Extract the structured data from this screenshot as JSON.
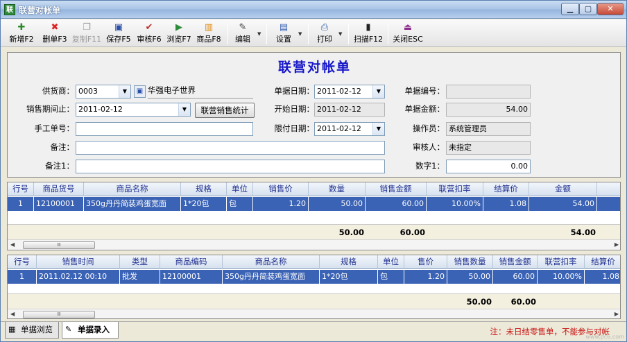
{
  "window": {
    "title": "联营对帐单",
    "app_icon_text": "联"
  },
  "toolbar": {
    "items": [
      {
        "label": "新增F2",
        "icon": "add-icon",
        "glyph": "✚"
      },
      {
        "label": "删单F3",
        "icon": "delete-icon",
        "glyph": "✖"
      },
      {
        "label": "复制F11",
        "icon": "copy-icon",
        "glyph": "❐"
      },
      {
        "label": "保存F5",
        "icon": "save-icon",
        "glyph": "▣"
      },
      {
        "label": "审核F6",
        "icon": "audit-icon",
        "glyph": "✔"
      },
      {
        "label": "浏览F7",
        "icon": "browse-icon",
        "glyph": "▶"
      },
      {
        "label": "商品F8",
        "icon": "product-icon",
        "glyph": "▥"
      },
      {
        "label": "编辑",
        "icon": "edit-icon",
        "glyph": "✎"
      },
      {
        "label": "设置",
        "icon": "settings-icon",
        "glyph": "▤"
      },
      {
        "label": "打印",
        "icon": "print-icon",
        "glyph": "⎙"
      },
      {
        "label": "扫描F12",
        "icon": "barcode-icon",
        "glyph": "▮"
      },
      {
        "label": "关闭ESC",
        "icon": "exit-icon",
        "glyph": "⏏"
      }
    ]
  },
  "form": {
    "title": "联营对帐单",
    "supplier_label": "供货商：",
    "supplier_code": "0003",
    "supplier_name": "华强电子世界",
    "sales_period_label": "销售期间止：",
    "sales_period_value": "2011-02-12",
    "stat_button": "联营销售统计",
    "manual_no_label": "手工单号：",
    "manual_no_value": "",
    "remark_label": "备注：",
    "remark_value": "",
    "remark1_label": "备注1：",
    "remark1_value": "",
    "doc_date_label": "单据日期：",
    "doc_date_value": "2011-02-12",
    "start_date_label": "开始日期：",
    "start_date_value": "2011-02-12",
    "limit_date_label": "限付日期：",
    "limit_date_value": "2011-02-12",
    "doc_no_label": "单据编号：",
    "doc_no_value": "",
    "doc_amount_label": "单据金额：",
    "doc_amount_value": "54.00",
    "operator_label": "操作员：",
    "operator_value": "系统管理员",
    "auditor_label": "审核人：",
    "auditor_value": "未指定",
    "number1_label": "数字1：",
    "number1_value": "0.00"
  },
  "grid1": {
    "headers": [
      "行号",
      "商品货号",
      "商品名称",
      "规格",
      "单位",
      "销售价",
      "数量",
      "销售金额",
      "联营扣率",
      "结算价",
      "金额"
    ],
    "rows": [
      [
        "1",
        "12100001",
        "350g丹丹简装鸡蛋宽面",
        "1*20包",
        "包",
        "1.20",
        "50.00",
        "60.00",
        "10.00%",
        "1.08",
        "54.00"
      ]
    ],
    "totals": {
      "qty": "50.00",
      "sales_amount": "60.00",
      "amount": "54.00"
    }
  },
  "grid2": {
    "headers": [
      "行号",
      "销售时间",
      "类型",
      "商品编码",
      "商品名称",
      "规格",
      "单位",
      "售价",
      "销售数量",
      "销售金额",
      "联营扣率",
      "结算价"
    ],
    "rows": [
      [
        "1",
        "2011.02.12 00:10",
        "批发",
        "12100001",
        "350g丹丹简装鸡蛋宽面",
        "1*20包",
        "包",
        "1.20",
        "50.00",
        "60.00",
        "10.00%",
        "1.08"
      ]
    ],
    "totals": {
      "qty": "50.00",
      "sales_amount": "60.00"
    }
  },
  "scrollbar": {
    "grip": "Ⅲ"
  },
  "statusbar": {
    "tabs": [
      {
        "label": "单据浏览",
        "icon": "grid-icon"
      },
      {
        "label": "单据录入",
        "icon": "pen-icon"
      }
    ],
    "note": "注：未日结零售单，不能参与对帐",
    "watermark": "www.pc6.com"
  },
  "colors": {
    "selection": "#3a62b5",
    "title_blue": "#1616c8",
    "note_red": "#c81010"
  }
}
